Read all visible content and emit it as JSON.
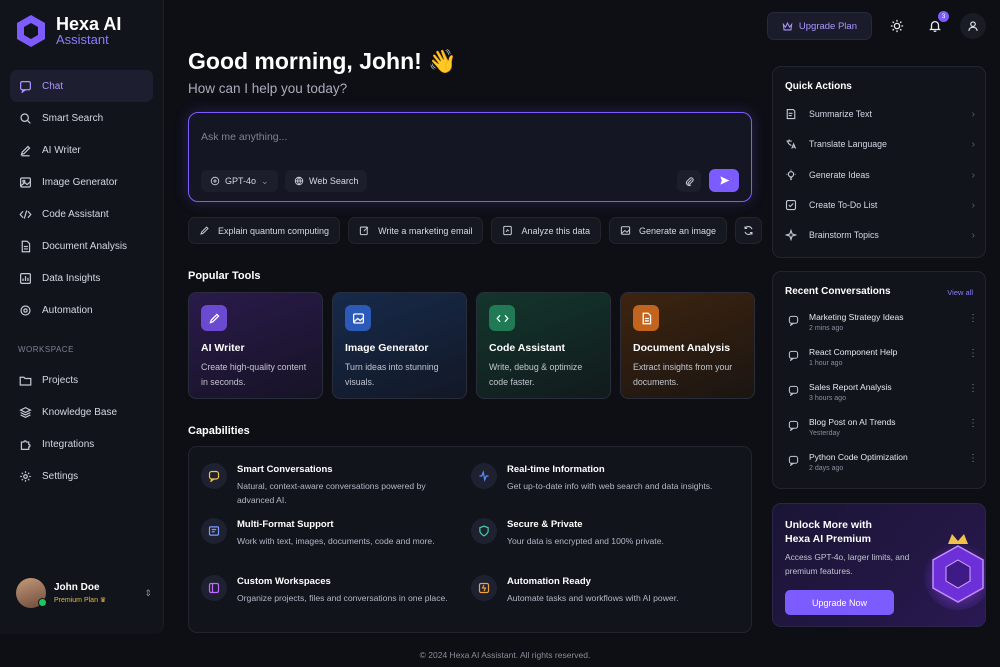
{
  "brand": {
    "name": "Hexa AI",
    "subtitle": "Assistant"
  },
  "sidebar": {
    "items": [
      {
        "label": "Chat",
        "icon": "chat-icon"
      },
      {
        "label": "Smart Search",
        "icon": "search-icon"
      },
      {
        "label": "AI Writer",
        "icon": "pen-icon"
      },
      {
        "label": "Image Generator",
        "icon": "image-icon"
      },
      {
        "label": "Code Assistant",
        "icon": "code-icon"
      },
      {
        "label": "Document Analysis",
        "icon": "document-icon"
      },
      {
        "label": "Data Insights",
        "icon": "chart-icon"
      },
      {
        "label": "Automation",
        "icon": "automation-icon"
      }
    ],
    "workspace_label": "WORKSPACE",
    "workspace_items": [
      {
        "label": "Projects",
        "icon": "folder-icon"
      },
      {
        "label": "Knowledge Base",
        "icon": "layers-icon"
      },
      {
        "label": "Integrations",
        "icon": "puzzle-icon"
      },
      {
        "label": "Settings",
        "icon": "gear-icon"
      }
    ]
  },
  "user": {
    "name": "John Doe",
    "plan": "Premium Plan"
  },
  "topbar": {
    "upgrade_label": "Upgrade Plan",
    "notification_count": "3"
  },
  "main": {
    "greeting": "Good morning, John! 👋",
    "subgreeting": "How can I help you today?",
    "chat": {
      "placeholder": "Ask me anything...",
      "model": "GPT-4o",
      "web_search": "Web Search"
    },
    "suggestions": [
      "Explain quantum computing",
      "Write a marketing email",
      "Analyze this data",
      "Generate an image"
    ],
    "popular_tools_title": "Popular Tools",
    "tools": [
      {
        "title": "AI Writer",
        "desc": "Create high-quality content in seconds."
      },
      {
        "title": "Image Generator",
        "desc": "Turn ideas into stunning visuals."
      },
      {
        "title": "Code Assistant",
        "desc": "Write, debug & optimize code faster."
      },
      {
        "title": "Document Analysis",
        "desc": "Extract insights from your documents."
      }
    ],
    "capabilities_title": "Capabilities",
    "capabilities": [
      {
        "title": "Smart Conversations",
        "desc": "Natural, context-aware conversations powered by advanced AI."
      },
      {
        "title": "Real-time Information",
        "desc": "Get up-to-date info with web search and data insights."
      },
      {
        "title": "Multi-Format Support",
        "desc": "Work with text, images, documents, code and more."
      },
      {
        "title": "Secure & Private",
        "desc": "Your data is encrypted and 100% private."
      },
      {
        "title": "Custom Workspaces",
        "desc": "Organize projects, files and conversations in one place."
      },
      {
        "title": "Automation Ready",
        "desc": "Automate tasks and workflows with AI power."
      }
    ]
  },
  "quick_actions": {
    "title": "Quick Actions",
    "items": [
      "Summarize Text",
      "Translate Language",
      "Generate Ideas",
      "Create To-Do List",
      "Brainstorm Topics"
    ]
  },
  "recent": {
    "title": "Recent Conversations",
    "view_all": "View all",
    "items": [
      {
        "title": "Marketing Strategy Ideas",
        "time": "2 mins ago"
      },
      {
        "title": "React Component Help",
        "time": "1 hour ago"
      },
      {
        "title": "Sales Report Analysis",
        "time": "3 hours ago"
      },
      {
        "title": "Blog Post on AI Trends",
        "time": "Yesterday"
      },
      {
        "title": "Python Code Optimization",
        "time": "2 days ago"
      }
    ]
  },
  "premium": {
    "title": "Unlock More with Hexa AI Premium",
    "desc": "Access GPT-4o, larger limits, and premium features.",
    "button": "Upgrade Now"
  },
  "footer": "© 2024 Hexa AI Assistant. All rights reserved.",
  "colors": {
    "accent": "#7c5cff",
    "background": "#0d0f15",
    "panel": "#12141c"
  }
}
